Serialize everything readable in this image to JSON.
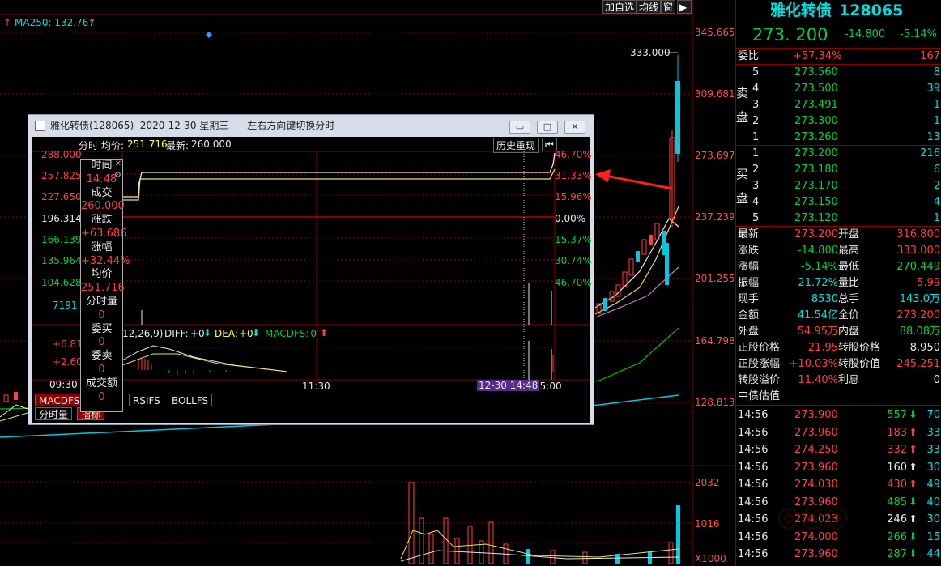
{
  "toolbar": {
    "add_watch": "加自选",
    "avg_line": "均线",
    "window": "窗",
    "back": "▶"
  },
  "ma_label": "MA250: 132.767",
  "price_axis": [
    "345.665",
    "309.681",
    "273.697",
    "237.239",
    "201.255",
    "164.798",
    "128.813"
  ],
  "high_label": "333.000",
  "volume_axis": [
    "2032",
    "1016",
    "X1000"
  ],
  "stock": {
    "name": "雅化转债",
    "code": "128065",
    "price": "273. 200",
    "change": "-14.800",
    "pct": "-5.14%"
  },
  "weibi": {
    "label": "委比",
    "pct": "+57.34%",
    "diff": "167"
  },
  "sell_label": "卖盘",
  "buy_label": "买盘",
  "sell": [
    {
      "lvl": "5",
      "price": "273.560",
      "vol": "8"
    },
    {
      "lvl": "4",
      "price": "273.500",
      "vol": "39"
    },
    {
      "lvl": "3",
      "price": "273.491",
      "vol": "1"
    },
    {
      "lvl": "2",
      "price": "273.300",
      "vol": "1"
    },
    {
      "lvl": "1",
      "price": "273.260",
      "vol": "13"
    }
  ],
  "buy": [
    {
      "lvl": "1",
      "price": "273.200",
      "vol": "216"
    },
    {
      "lvl": "2",
      "price": "273.180",
      "vol": "6"
    },
    {
      "lvl": "3",
      "price": "273.170",
      "vol": "2"
    },
    {
      "lvl": "4",
      "price": "273.150",
      "vol": "4"
    },
    {
      "lvl": "5",
      "price": "273.120",
      "vol": "1"
    }
  ],
  "quote": [
    {
      "l1": "最新",
      "v1": "273.200",
      "c1": "red",
      "l2": "开盘",
      "v2": "316.800",
      "c2": "red"
    },
    {
      "l1": "涨跌",
      "v1": "-14.800",
      "c1": "green",
      "l2": "最高",
      "v2": "333.000",
      "c2": "red"
    },
    {
      "l1": "涨幅",
      "v1": "-5.14%",
      "c1": "green",
      "l2": "最低",
      "v2": "270.449",
      "c2": "green"
    },
    {
      "l1": "振幅",
      "v1": "21.72%",
      "c1": "cyan",
      "l2": "量比",
      "v2": "5.99",
      "c2": "red"
    },
    {
      "l1": "现手",
      "v1": "8530",
      "c1": "cyan",
      "l2": "总手",
      "v2": "143.0万",
      "c2": "cyan"
    },
    {
      "l1": "金额",
      "v1": "41.54亿",
      "c1": "cyan",
      "l2": "全价",
      "v2": "273.200",
      "c2": "red"
    },
    {
      "l1": "外盘",
      "v1": "54.95万",
      "c1": "red",
      "l2": "内盘",
      "v2": "88.08万",
      "c2": "green"
    },
    {
      "l1": "正股价格",
      "v1": "21.95",
      "c1": "red",
      "l2": "转股价格",
      "v2": "8.950",
      "c2": "white"
    },
    {
      "l1": "正股涨幅",
      "v1": "+10.03%",
      "c1": "red",
      "l2": "转股价值",
      "v2": "245.251",
      "c2": "red"
    },
    {
      "l1": "转股溢价",
      "v1": "11.40%",
      "c1": "red",
      "l2": "利息",
      "v2": "0",
      "c2": "white"
    }
  ],
  "zhongzhai": "中债估值",
  "trades": [
    {
      "t": "14:56",
      "p": "273.900",
      "v": "557",
      "d": "down",
      "n": "70"
    },
    {
      "t": "14:56",
      "p": "273.960",
      "v": "183",
      "d": "up",
      "n": "33"
    },
    {
      "t": "14:56",
      "p": "274.250",
      "v": "332",
      "d": "up",
      "n": "33"
    },
    {
      "t": "14:56",
      "p": "273.960",
      "v": "160",
      "d": "up-w",
      "n": "30"
    },
    {
      "t": "14:56",
      "p": "274.030",
      "v": "430",
      "d": "up",
      "n": "49"
    },
    {
      "t": "14:56",
      "p": "273.960",
      "v": "485",
      "d": "down",
      "n": "40"
    },
    {
      "t": "14:56",
      "p": "274.023",
      "v": "246",
      "d": "up-w",
      "n": "30"
    },
    {
      "t": "14:56",
      "p": "274.000",
      "v": "266",
      "d": "down",
      "n": "15"
    },
    {
      "t": "14:56",
      "p": "273.960",
      "v": "287",
      "d": "down",
      "n": "44"
    }
  ],
  "popup": {
    "title": "雅化转债(128065)  2020-12-30 星期三      左右方向键切换分时",
    "header_fs": "分时",
    "header_avg_label": "均价:",
    "header_avg": "251.716",
    "header_latest_label": "最新:",
    "header_latest": "260.000",
    "history_btn": "历史重现",
    "left_prices": [
      "288.000",
      "257.825",
      "227.650",
      "196.314",
      "166.139",
      "135.964",
      "104.628"
    ],
    "right_pcts": [
      "46.70%",
      "31.33%",
      "15.96%",
      "0.00%",
      "15.37%",
      "30.74%",
      "46.70%"
    ],
    "vol_label": "7191",
    "macd_left": [
      "+6.81",
      "+2.60"
    ],
    "time_labels": [
      "09:30",
      "11:30",
      "15:00"
    ],
    "cursor_label": "12-30 14:48",
    "macd_header": {
      "params": "12,26,9)",
      "diff_label": "DIFF:",
      "diff": "+0",
      "dea_label": "DEA:",
      "dea": "+0",
      "macdfs_label": "MACDFS:",
      "macdfs": "-0"
    },
    "tabs": [
      "MACDFS",
      "RSIFS",
      "BOLLFS"
    ],
    "bottom_tabs": [
      "分时量",
      "指标"
    ],
    "tooltip": [
      "时间",
      "14:48",
      "成交",
      "260.000",
      "涨跌",
      "+63.686",
      "涨幅",
      "+32.44%",
      "均价",
      "251.716",
      "分时量",
      "0",
      "委买",
      "0",
      "委卖",
      "0",
      "成交额",
      "0"
    ]
  },
  "colors": {
    "up": "#ff4040",
    "down": "#00d040",
    "grid": "#8a0000",
    "cyan": "#00e0e0"
  }
}
